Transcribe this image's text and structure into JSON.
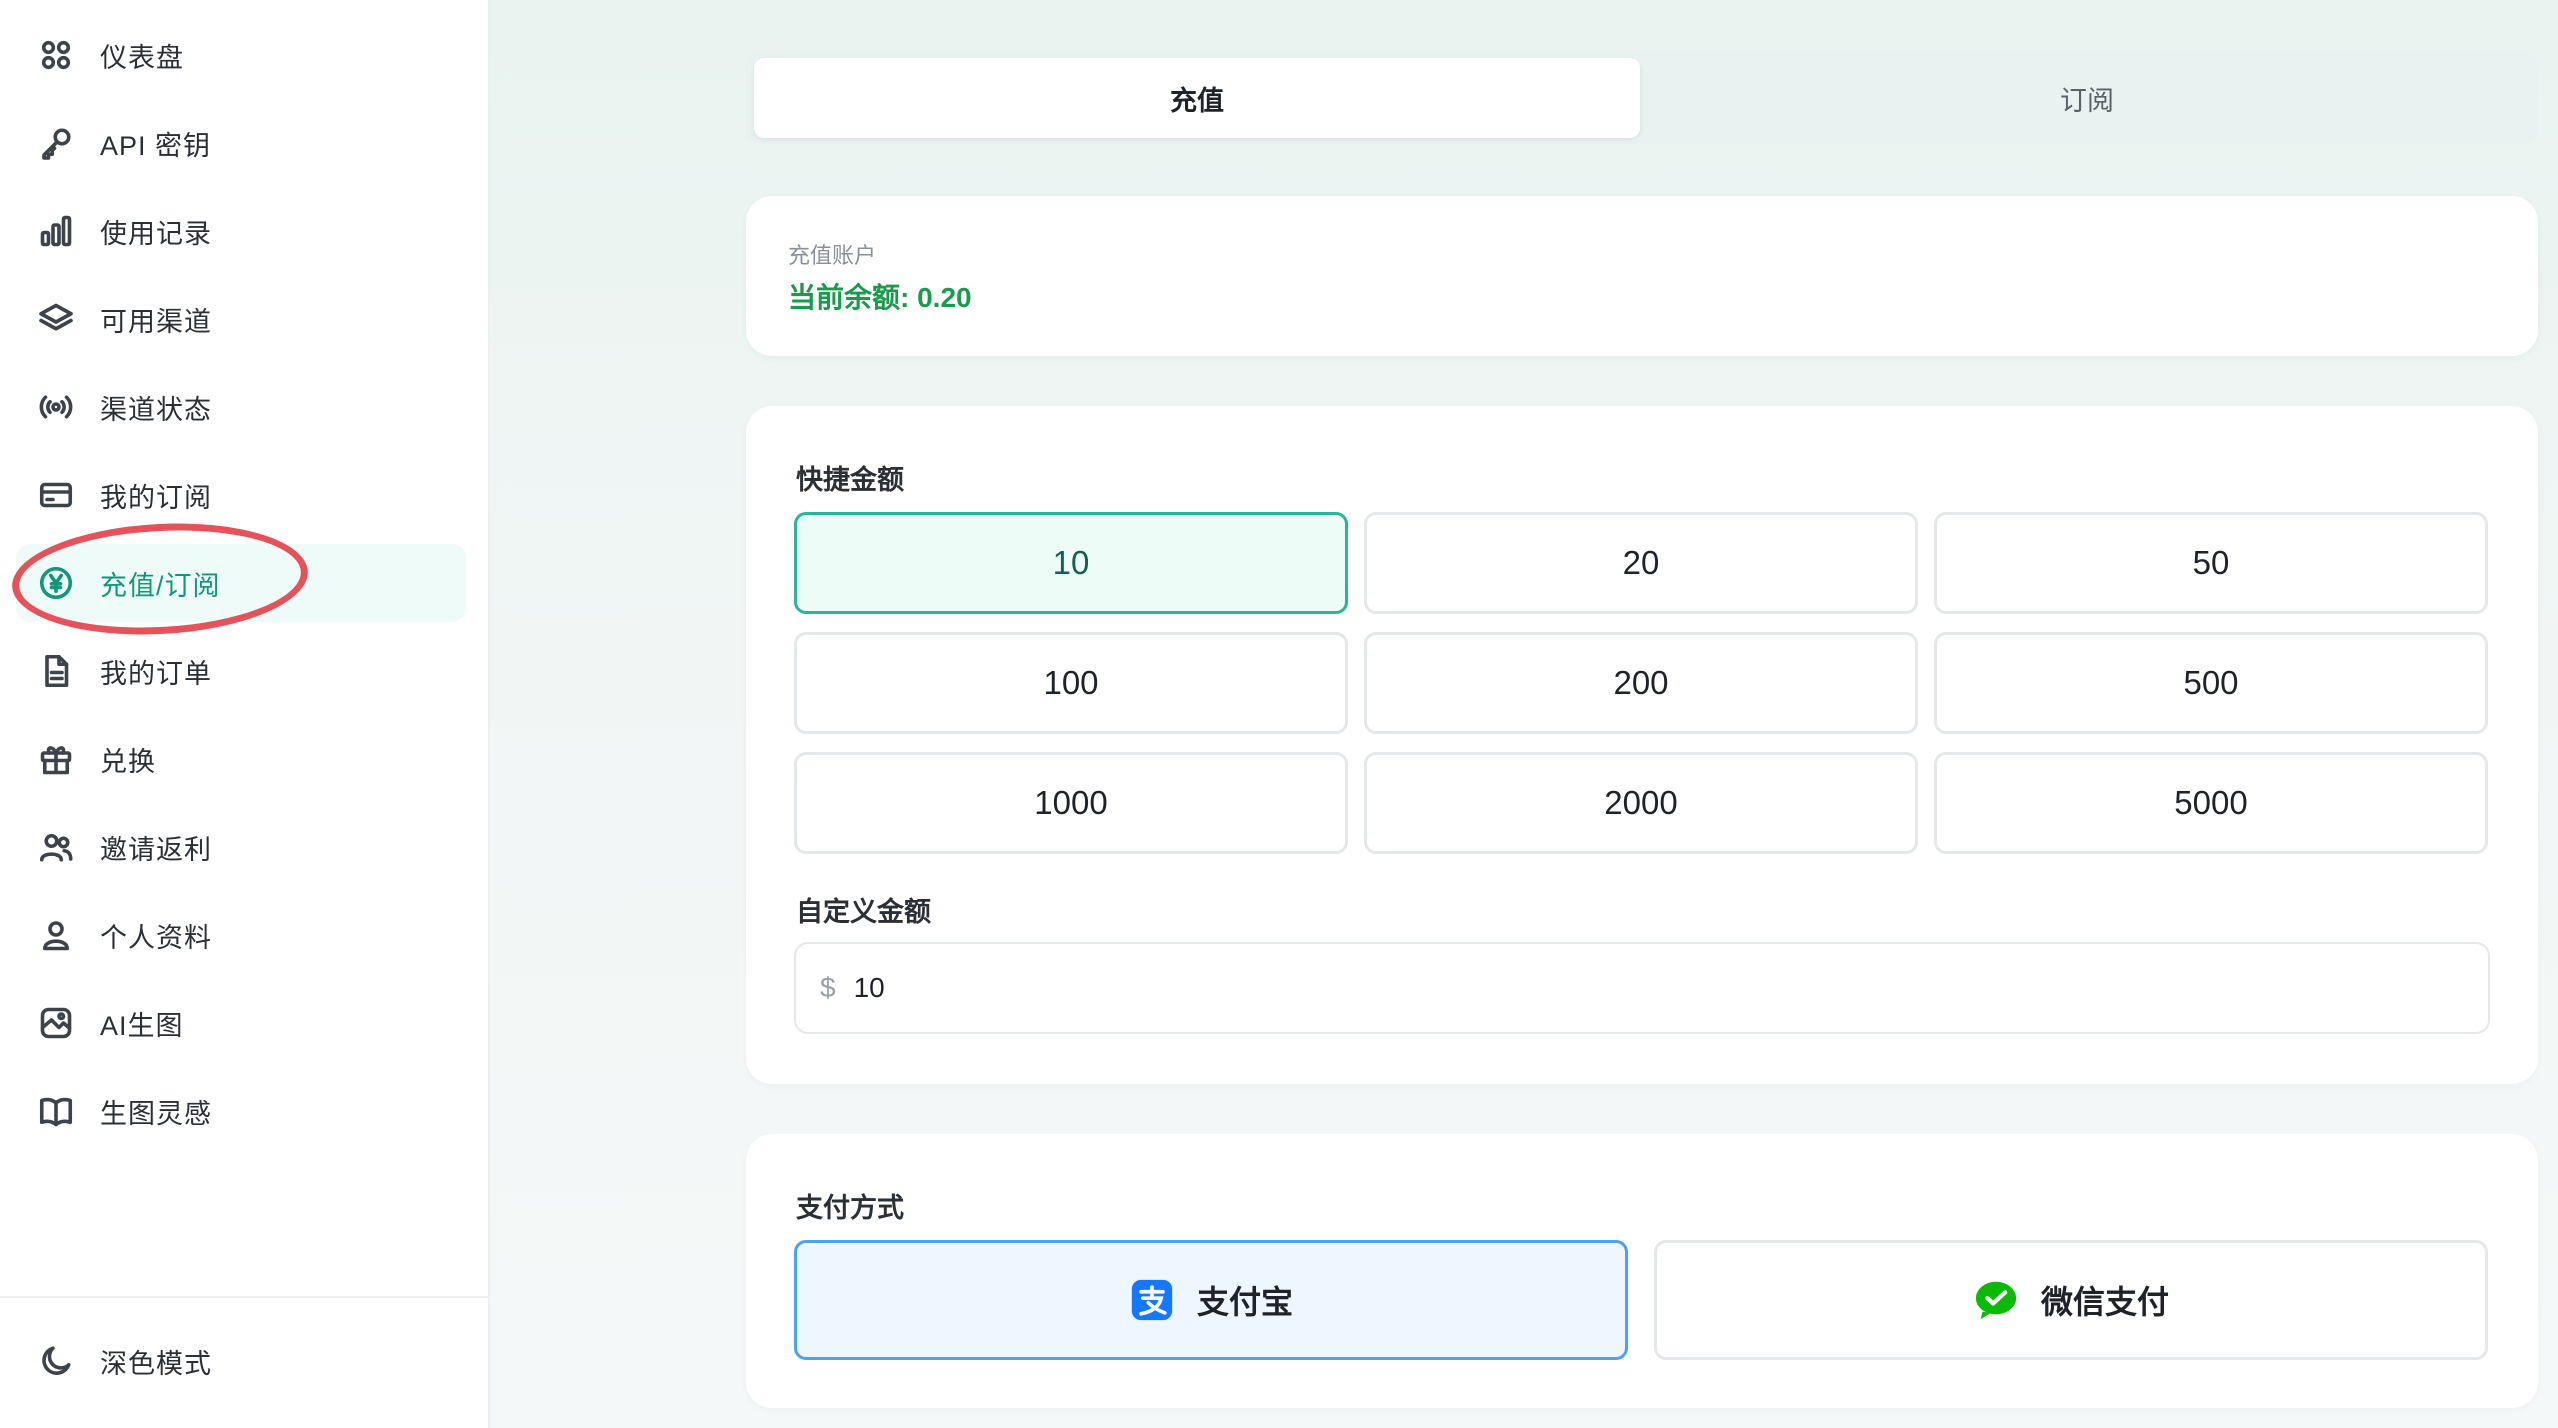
{
  "sidebar": {
    "items": [
      {
        "label": "仪表盘",
        "icon": "dashboard-icon"
      },
      {
        "label": "API 密钥",
        "icon": "key-icon"
      },
      {
        "label": "使用记录",
        "icon": "bar-chart-icon"
      },
      {
        "label": "可用渠道",
        "icon": "layers-icon"
      },
      {
        "label": "渠道状态",
        "icon": "broadcast-icon"
      },
      {
        "label": "我的订阅",
        "icon": "credit-card-icon"
      },
      {
        "label": "充值/订阅",
        "icon": "yen-coin-icon",
        "active": true
      },
      {
        "label": "我的订单",
        "icon": "document-icon"
      },
      {
        "label": "兑换",
        "icon": "gift-icon"
      },
      {
        "label": "邀请返利",
        "icon": "users-icon"
      },
      {
        "label": "个人资料",
        "icon": "user-icon"
      },
      {
        "label": "AI生图",
        "icon": "image-gen-icon"
      },
      {
        "label": "生图灵感",
        "icon": "book-icon"
      }
    ],
    "dark_mode_label": "深色模式"
  },
  "tabs": [
    {
      "label": "充值",
      "active": true
    },
    {
      "label": "订阅",
      "active": false
    }
  ],
  "account": {
    "label": "充值账户",
    "balance_text": "当前余额: 0.20"
  },
  "amounts": {
    "quick_label": "快捷金额",
    "options": [
      "10",
      "20",
      "50",
      "100",
      "200",
      "500",
      "1000",
      "2000",
      "5000"
    ],
    "selected": "10",
    "custom_label": "自定义金额",
    "currency_symbol": "$",
    "custom_value": "10"
  },
  "payment": {
    "label": "支付方式",
    "methods": [
      {
        "label": "支付宝",
        "icon": "alipay-icon",
        "selected": true
      },
      {
        "label": "微信支付",
        "icon": "wechat-pay-icon",
        "selected": false
      }
    ]
  },
  "colors": {
    "accent": "#14967a",
    "balance": "#1a9b4b",
    "annotation_ring": "#e5525a",
    "alipay_blue": "#1677ff",
    "wechat_green": "#09bb07"
  }
}
